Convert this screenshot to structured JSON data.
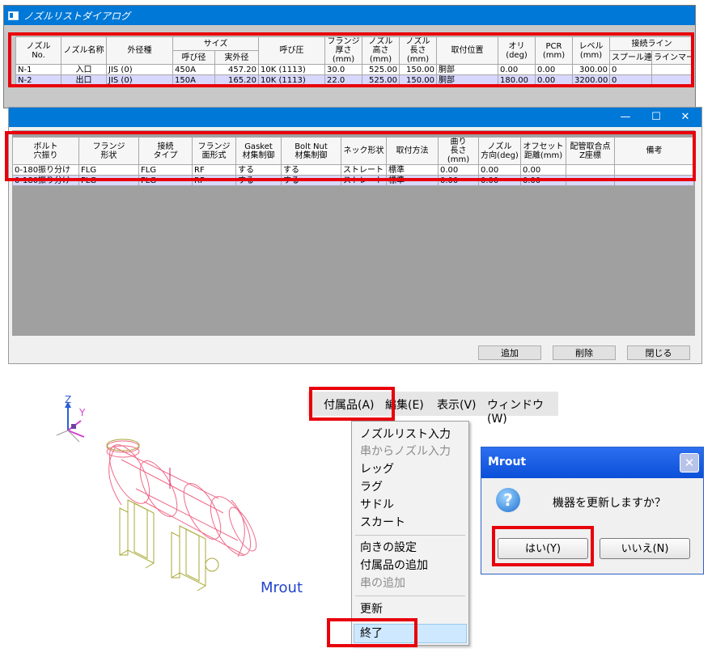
{
  "window1": {
    "title": "ノズルリストダイアログ",
    "headers": {
      "nozzle_no": "ノズル\nNo.",
      "nozzle_name": "ノズル名称",
      "outer_dia_type": "外径種",
      "size": "サイズ",
      "nominal": "呼び径",
      "actual_od": "実外径",
      "pressure": "呼び圧",
      "flange_thk": "フランジ\n厚さ(mm)",
      "nozzle_height": "ノズル\n高さ(mm)",
      "nozzle_length": "ノズル\n長さ(mm)",
      "position": "取付位置",
      "ori": "オリ\n(deg)",
      "pcr": "PCR\n(mm)",
      "level": "レベル\n(mm)",
      "conn_line": "接続ライン",
      "spool": "スプール連",
      "line_mark": "ラインマーク"
    },
    "rows": [
      {
        "no": "N-1",
        "name": "入口",
        "od_type": "JIS (0)",
        "nominal": "450A",
        "actual": "457.20",
        "pressure": "10K (1113)",
        "thk": "30.0",
        "height": "525.00",
        "length": "150.00",
        "pos": "胴部",
        "ori": "0.00",
        "pcr": "0.00",
        "level": "300.00",
        "spool": "0",
        "mark": ""
      },
      {
        "no": "N-2",
        "name": "出口",
        "od_type": "JIS (0)",
        "nominal": "150A",
        "actual": "165.20",
        "pressure": "10K (1113)",
        "thk": "22.0",
        "height": "525.00",
        "length": "150.00",
        "pos": "胴部",
        "ori": "180.00",
        "pcr": "0.00",
        "level": "3200.00",
        "spool": "0",
        "mark": ""
      }
    ]
  },
  "window2": {
    "min_btn": "—",
    "max_btn": "☐",
    "close_btn": "✕",
    "headers": {
      "bolt": "ボルト\n穴振り",
      "flange_shape": "フランジ\n形状",
      "conn_type": "接続\nタイプ",
      "face_type": "フランジ\n面形式",
      "gasket": "Gasket\n材集制御",
      "bolt_nut": "Bolt Nut\n材集制御",
      "neck": "ネック形状",
      "method": "取付方法",
      "bend": "曲り\n長さ(mm)",
      "dir": "ノズル\n方向(deg)",
      "offset": "オフセット\n距離(mm)",
      "pipe_z": "配管取合点\nZ座標",
      "note": "備考"
    },
    "rows": [
      {
        "bolt": "0-180振り分け",
        "flange": "FLG",
        "conn": "FLG",
        "face": "RF",
        "gasket": "する",
        "boltnut": "する",
        "neck": "ストレート",
        "method": "標準",
        "bend": "0.00",
        "dir": "0.00",
        "offset": "0.00",
        "pipe_z": "",
        "note": ""
      },
      {
        "bolt": "0-180振り分け",
        "flange": "FLG",
        "conn": "FLG",
        "face": "RF",
        "gasket": "する",
        "boltnut": "する",
        "neck": "ストレート",
        "method": "標準",
        "bend": "0.00",
        "dir": "0.00",
        "offset": "0.00",
        "pipe_z": "",
        "note": ""
      }
    ],
    "buttons": {
      "add": "追加",
      "delete": "削除",
      "close": "閉じる"
    }
  },
  "viewport": {
    "axis_z": "Z",
    "axis_y": "Y",
    "app_label": "Mrout"
  },
  "menubar": {
    "items": [
      "付属品(A)",
      "編集(E)",
      "表示(V)",
      "ウィンドウ(W)"
    ]
  },
  "dropdown": {
    "items": [
      {
        "label": "ノズルリスト入力",
        "enabled": true
      },
      {
        "label": "串からノズル入力",
        "enabled": false
      },
      {
        "label": "レッグ",
        "enabled": true
      },
      {
        "label": "ラグ",
        "enabled": true
      },
      {
        "label": "サドル",
        "enabled": true
      },
      {
        "label": "スカート",
        "enabled": true
      },
      {
        "label": "向きの設定",
        "enabled": true
      },
      {
        "label": "付属品の追加",
        "enabled": true
      },
      {
        "label": "串の追加",
        "enabled": false
      },
      {
        "label": "更新",
        "enabled": true
      },
      {
        "label": "終了",
        "enabled": true
      }
    ]
  },
  "dialog": {
    "title": "Mrout",
    "close": "✕",
    "icon": "?",
    "message": "機器を更新しますか？",
    "yes": "はい(Y)",
    "no": "いいえ(N)"
  },
  "colors": {
    "highlight_box": "#e8000b",
    "titlebar_blue": "#0078d7",
    "vessel_pink": "#f06a8a",
    "support_olive": "#a8a838",
    "mrout_label": "#2244cc"
  }
}
